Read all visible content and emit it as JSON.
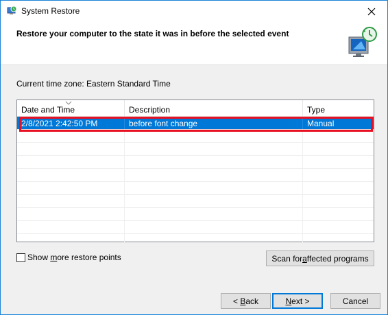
{
  "window": {
    "title": "System Restore",
    "icons": {
      "app": "system-restore-icon",
      "close": "close-icon",
      "header": "monitor-restore-clock-icon"
    }
  },
  "header": {
    "title": "Restore your computer to the state it was in before the selected event"
  },
  "timezone_text": "Current time zone: Eastern Standard Time",
  "list": {
    "columns": [
      "Date and Time",
      "Description",
      "Type"
    ],
    "sort_icon": "sort-down-icon",
    "rows": [
      {
        "datetime": "2/8/2021 2:42:50 PM",
        "description": "before font change",
        "type": "Manual",
        "selected": true
      }
    ],
    "empty_rows": 9,
    "colors": {
      "selection": "#0078d7",
      "highlight_box": "#e81123"
    }
  },
  "show_more": {
    "label_pre": "Show ",
    "label_acc": "m",
    "label_post": "ore restore points",
    "checked": false
  },
  "buttons": {
    "scan_pre": "Scan for ",
    "scan_acc": "a",
    "scan_post": "ffected programs",
    "back_pre": "< ",
    "back_acc": "B",
    "back_post": "ack",
    "next_acc": "N",
    "next_post": "ext >",
    "cancel": "Cancel"
  }
}
